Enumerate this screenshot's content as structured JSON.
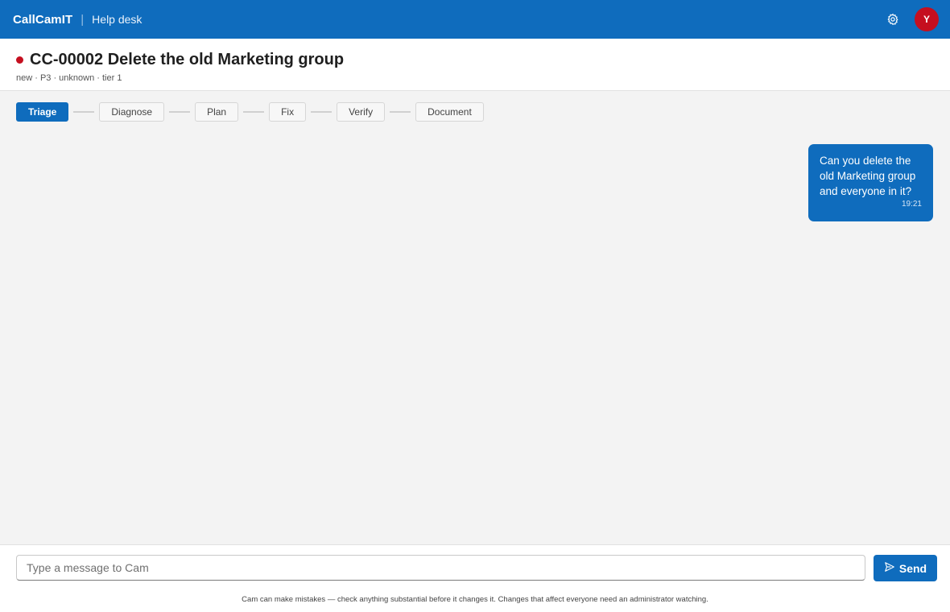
{
  "header": {
    "brand": "CallCamIT",
    "divider": "|",
    "section": "Help desk",
    "settings_icon": "gear-icon",
    "avatar_initial": "Y"
  },
  "ticket": {
    "status_color": "#c50f1f",
    "title": "CC-00002 Delete the old Marketing group",
    "meta": "new · P3 · unknown · tier 1"
  },
  "steps": [
    {
      "label": "Triage",
      "active": true
    },
    {
      "label": "Diagnose",
      "active": false
    },
    {
      "label": "Plan",
      "active": false
    },
    {
      "label": "Fix",
      "active": false
    },
    {
      "label": "Verify",
      "active": false
    },
    {
      "label": "Document",
      "active": false
    }
  ],
  "messages": [
    {
      "text": "Can you delete the old Marketing group and everyone in it?",
      "time": "19:21",
      "from": "user"
    }
  ],
  "composer": {
    "placeholder": "Type a message to Cam",
    "value": "",
    "send_label": "Send",
    "send_icon": "send-icon",
    "disclaimer": "Cam can make mistakes — check anything substantial before it changes it. Changes that affect everyone need an administrator watching."
  },
  "colors": {
    "accent": "#0f6cbd",
    "avatar": "#c50f1f"
  }
}
